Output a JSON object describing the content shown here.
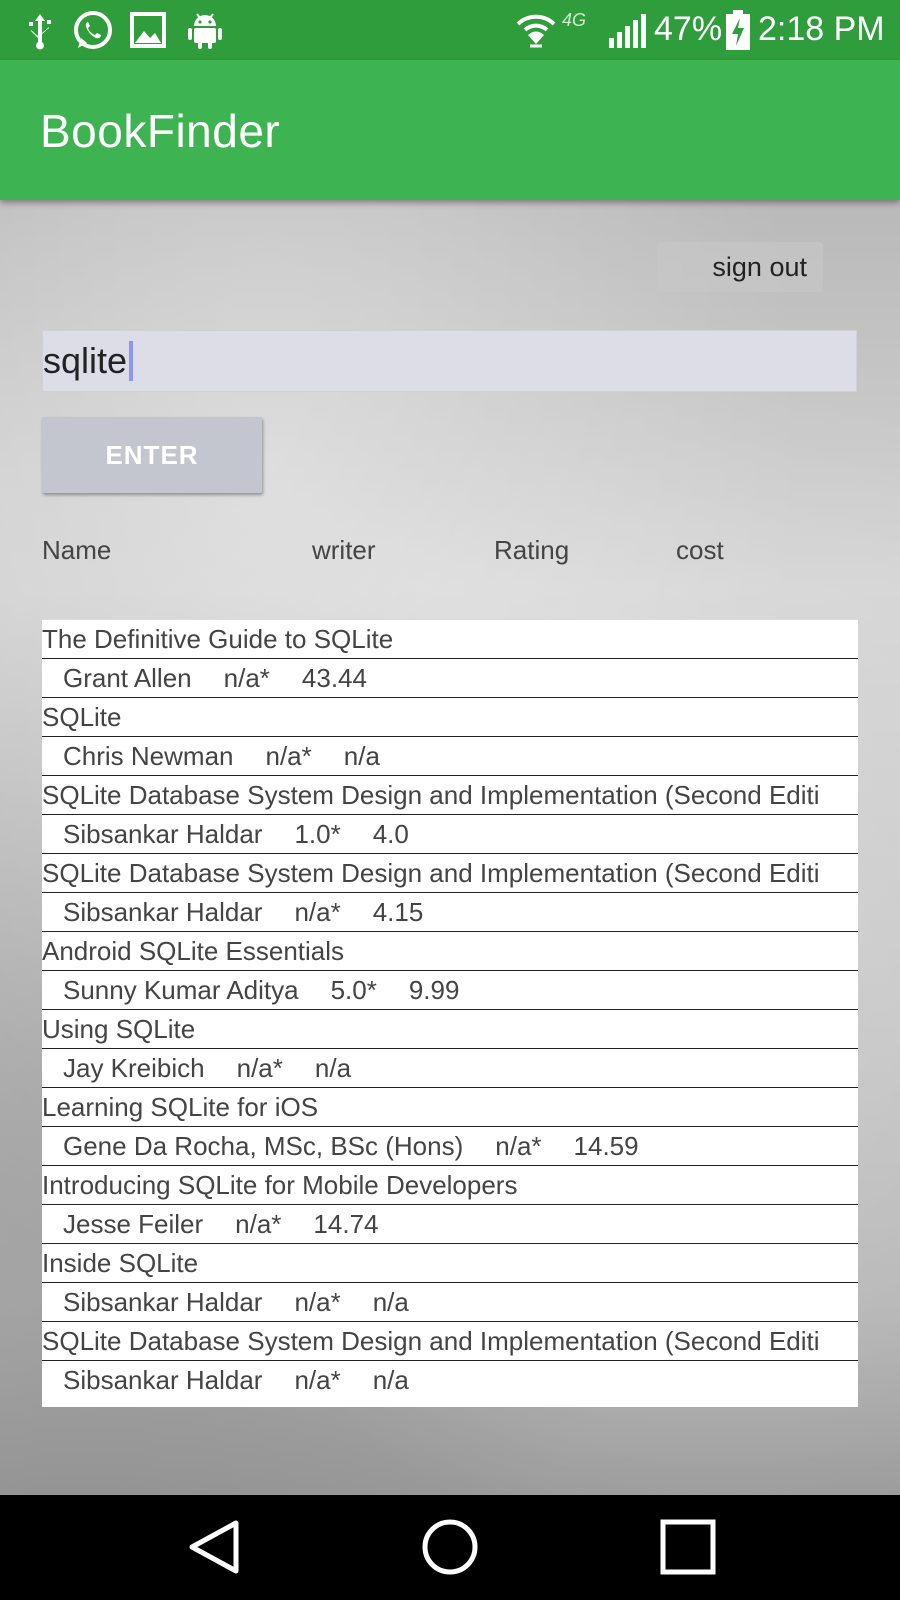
{
  "status_bar": {
    "battery": "47%",
    "time": "2:18 PM",
    "network": "4G",
    "icons": [
      "usb-icon",
      "whatsapp-icon",
      "image-icon",
      "android-icon",
      "wifi-icon",
      "signal-icon",
      "battery-charging-icon"
    ]
  },
  "app_bar": {
    "title": "BookFinder"
  },
  "signout_label": "sign out",
  "search": {
    "value": "sqlite"
  },
  "enter_label": "ENTER",
  "columns": {
    "name": "Name",
    "writer": "writer",
    "rating": "Rating",
    "cost": "cost"
  },
  "results": [
    {
      "title": "The Definitive Guide to SQLite",
      "writer": "Grant Allen",
      "rating": "n/a*",
      "cost": "43.44"
    },
    {
      "title": "SQLite",
      "writer": "Chris Newman",
      "rating": "n/a*",
      "cost": "n/a"
    },
    {
      "title": "SQLite Database System Design and Implementation (Second Editi",
      "writer": "Sibsankar Haldar",
      "rating": "1.0*",
      "cost": "4.0"
    },
    {
      "title": "SQLite Database System Design and Implementation (Second Editi",
      "writer": "Sibsankar Haldar",
      "rating": "n/a*",
      "cost": "4.15"
    },
    {
      "title": "Android SQLite Essentials",
      "writer": "Sunny Kumar Aditya",
      "rating": "5.0*",
      "cost": "9.99"
    },
    {
      "title": "Using SQLite",
      "writer": "Jay Kreibich",
      "rating": "n/a*",
      "cost": "n/a"
    },
    {
      "title": "Learning SQLite for iOS",
      "writer": "Gene Da Rocha, MSc, BSc (Hons)",
      "rating": "n/a*",
      "cost": "14.59"
    },
    {
      "title": "Introducing SQLite for Mobile Developers",
      "writer": "Jesse Feiler",
      "rating": "n/a*",
      "cost": "14.74"
    },
    {
      "title": "Inside SQLite",
      "writer": "Sibsankar Haldar",
      "rating": "n/a*",
      "cost": "n/a"
    },
    {
      "title": "SQLite Database System Design and Implementation (Second Editi",
      "writer": "Sibsankar Haldar",
      "rating": "n/a*",
      "cost": "n/a"
    }
  ],
  "nav": [
    "back-icon",
    "home-icon",
    "recents-icon"
  ]
}
